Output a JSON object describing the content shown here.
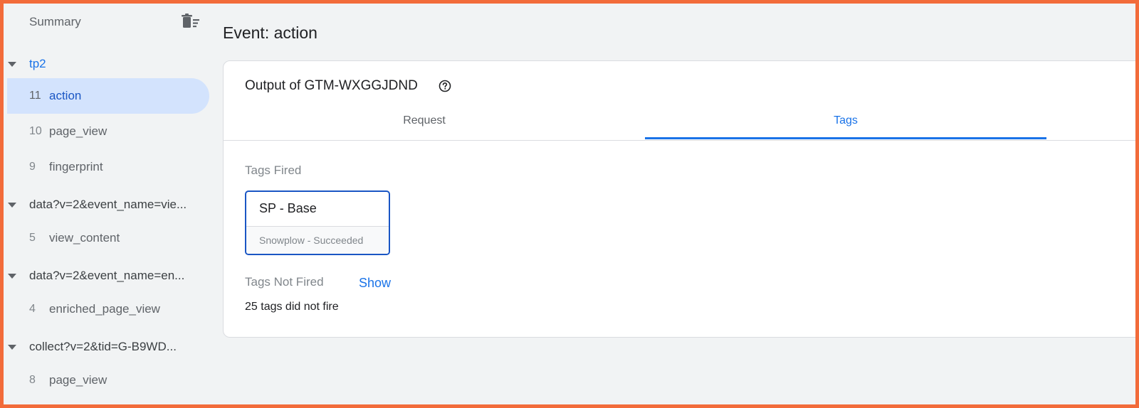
{
  "sidebar": {
    "summary_label": "Summary",
    "summary_icon": "delete-sweep-icon",
    "groups": [
      {
        "label": "tp2",
        "active": true,
        "events": [
          {
            "num": "11",
            "name": "action",
            "selected": true
          },
          {
            "num": "10",
            "name": "page_view",
            "selected": false
          },
          {
            "num": "9",
            "name": "fingerprint",
            "selected": false
          }
        ]
      },
      {
        "label": "data?v=2&event_name=vie...",
        "active": false,
        "events": [
          {
            "num": "5",
            "name": "view_content",
            "selected": false
          }
        ]
      },
      {
        "label": "data?v=2&event_name=en...",
        "active": false,
        "events": [
          {
            "num": "4",
            "name": "enriched_page_view",
            "selected": false
          }
        ]
      },
      {
        "label": "collect?v=2&tid=G-B9WD...",
        "active": false,
        "events": [
          {
            "num": "8",
            "name": "page_view",
            "selected": false
          }
        ]
      }
    ]
  },
  "main": {
    "event_title": "Event: action",
    "card": {
      "title": "Output of GTM-WXGGJDND",
      "help_icon": "help-circle-icon",
      "tabs": [
        {
          "label": "Request",
          "active": false
        },
        {
          "label": "Tags",
          "active": true
        }
      ],
      "tags_fired_label": "Tags Fired",
      "fired_tag": {
        "name": "SP - Base",
        "status": "Snowplow - Succeeded"
      },
      "tags_not_fired_label": "Tags Not Fired",
      "show_label": "Show",
      "not_fired_text": "25 tags did not fire"
    }
  },
  "colors": {
    "accent": "#1a73e8",
    "selected_bg": "#d3e3fd",
    "frame_border": "#f26b3a",
    "page_bg": "#f1f3f4"
  }
}
